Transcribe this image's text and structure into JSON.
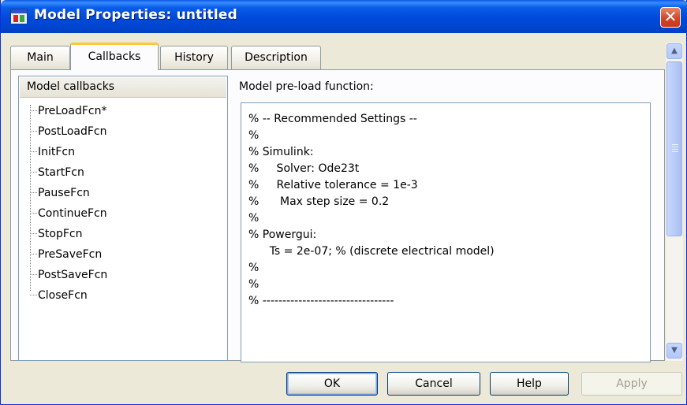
{
  "window": {
    "title": "Model Properties: untitled",
    "close_symbol": "✕"
  },
  "tabs": [
    {
      "label": "Main",
      "active": false
    },
    {
      "label": "Callbacks",
      "active": true
    },
    {
      "label": "History",
      "active": false
    },
    {
      "label": "Description",
      "active": false
    }
  ],
  "callbacks": {
    "header": "Model callbacks",
    "items": [
      "PreLoadFcn*",
      "PostLoadFcn",
      "InitFcn",
      "StartFcn",
      "PauseFcn",
      "ContinueFcn",
      "StopFcn",
      "PreSaveFcn",
      "PostSaveFcn",
      "CloseFcn"
    ]
  },
  "editor": {
    "label": "Model pre-load function:",
    "lines": [
      "% -- Recommended Settings --",
      "%",
      "% Simulink:",
      "%     Solver: Ode23t",
      "%     Relative tolerance = 1e-3",
      "%      Max step size = 0.2",
      "%",
      "% Powergui:",
      "      Ts = 2e-07; % (discrete electrical model)",
      "%",
      "%",
      "% ---------------------------------"
    ]
  },
  "buttons": {
    "ok": "OK",
    "cancel": "Cancel",
    "help": "Help",
    "apply": "Apply"
  },
  "icons": {
    "scroll_up": "▲",
    "scroll_down": "▼"
  }
}
